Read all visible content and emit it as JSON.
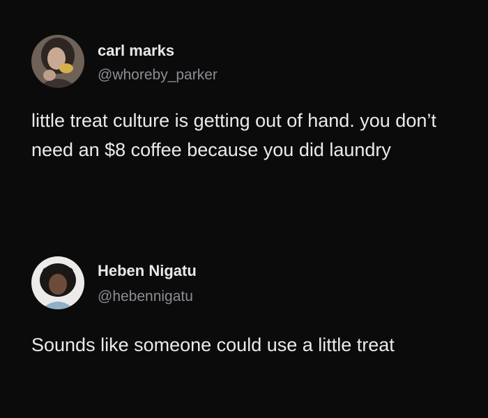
{
  "posts": [
    {
      "display_name": "carl marks",
      "handle": "@whoreby_parker",
      "avatar_icon": "profile-photo-icon",
      "text": "little treat culture is getting out of hand. you don’t need an $8 coffee because you did laundry"
    },
    {
      "display_name": "Heben Nigatu",
      "handle": "@hebennigatu",
      "avatar_icon": "profile-photo-icon",
      "text": "Sounds like someone could use a little treat"
    }
  ],
  "colors": {
    "background": "#0b0b0c",
    "text": "#ebebeb",
    "handle": "#8b8e92"
  }
}
